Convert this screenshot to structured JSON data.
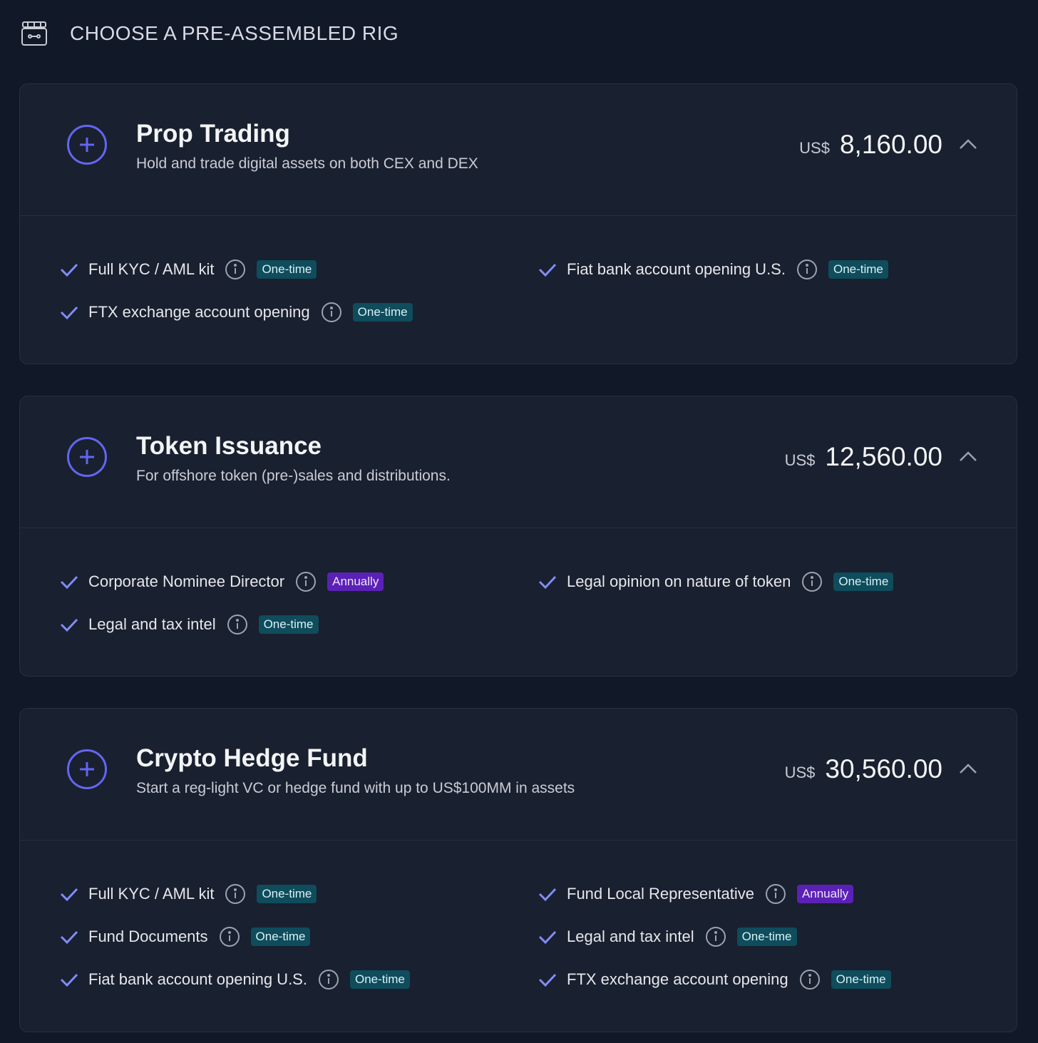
{
  "header": {
    "title": "CHOOSE A PRE-ASSEMBLED RIG",
    "icon": "toolbox-icon"
  },
  "colors": {
    "background": "#111827",
    "card": "#19202f",
    "accent": "#6366f1",
    "one_time": "#0f4c5c",
    "annually": "#5b21b6"
  },
  "cards": [
    {
      "title": "Prop Trading",
      "subtitle": "Hold and trade digital assets on both CEX and DEX",
      "currency": "US$",
      "price": "8,160.00",
      "features": [
        {
          "label": "Full KYC / AML kit",
          "badge": "One-time"
        },
        {
          "label": "Fiat bank account opening U.S.",
          "badge": "One-time"
        },
        {
          "label": "FTX exchange account opening",
          "badge": "One-time"
        }
      ]
    },
    {
      "title": "Token Issuance",
      "subtitle": "For offshore token (pre-)sales and distributions.",
      "currency": "US$",
      "price": "12,560.00",
      "features": [
        {
          "label": "Corporate Nominee Director",
          "badge": "Annually"
        },
        {
          "label": "Legal opinion on nature of token",
          "badge": "One-time"
        },
        {
          "label": "Legal and tax intel",
          "badge": "One-time"
        }
      ]
    },
    {
      "title": "Crypto Hedge Fund",
      "subtitle": "Start a reg-light VC or hedge fund with up to US$100MM in assets",
      "currency": "US$",
      "price": "30,560.00",
      "features": [
        {
          "label": "Full KYC / AML kit",
          "badge": "One-time"
        },
        {
          "label": "Fund Local Representative",
          "badge": "Annually"
        },
        {
          "label": "Fund Documents",
          "badge": "One-time"
        },
        {
          "label": "Legal and tax intel",
          "badge": "One-time"
        },
        {
          "label": "Fiat bank account opening U.S.",
          "badge": "One-time"
        },
        {
          "label": "FTX exchange account opening",
          "badge": "One-time"
        }
      ]
    }
  ]
}
